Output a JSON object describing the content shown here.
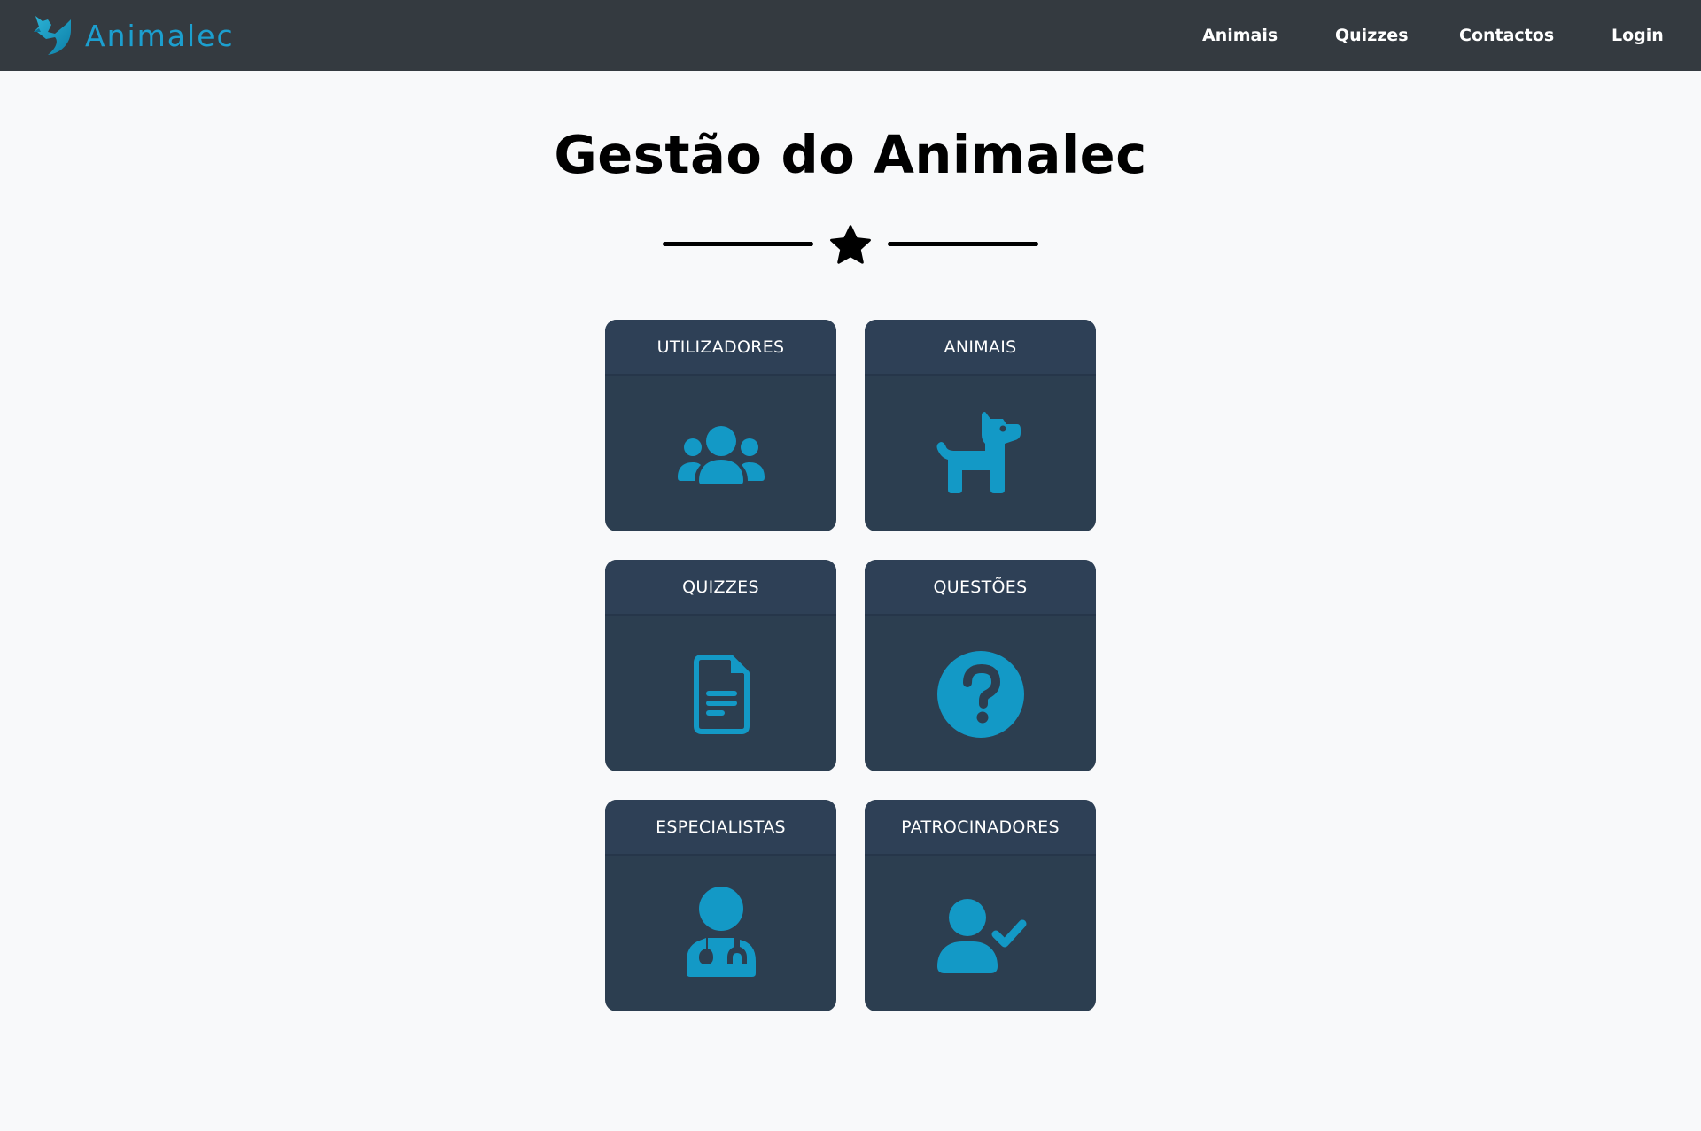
{
  "app": {
    "brand_name": "Animalec",
    "brand_color": "#1c9fcf"
  },
  "nav": {
    "items": [
      {
        "label": "Animais"
      },
      {
        "label": "Quizzes"
      },
      {
        "label": "Contactos"
      },
      {
        "label": "Login"
      }
    ],
    "background": "#343a40"
  },
  "main": {
    "title": "Gestão do Animalec",
    "divider_icon": "star-icon",
    "cards": [
      {
        "label": "UTILIZADORES",
        "icon": "users-icon"
      },
      {
        "label": "ANIMAIS",
        "icon": "dog-icon"
      },
      {
        "label": "QUIZZES",
        "icon": "document-icon"
      },
      {
        "label": "QUESTÕES",
        "icon": "question-circle-icon"
      },
      {
        "label": "ESPECIALISTAS",
        "icon": "doctor-icon"
      },
      {
        "label": "PATROCINADORES",
        "icon": "user-check-icon"
      }
    ],
    "card_background": "#2c3e50",
    "icon_color": "#1399c6"
  }
}
